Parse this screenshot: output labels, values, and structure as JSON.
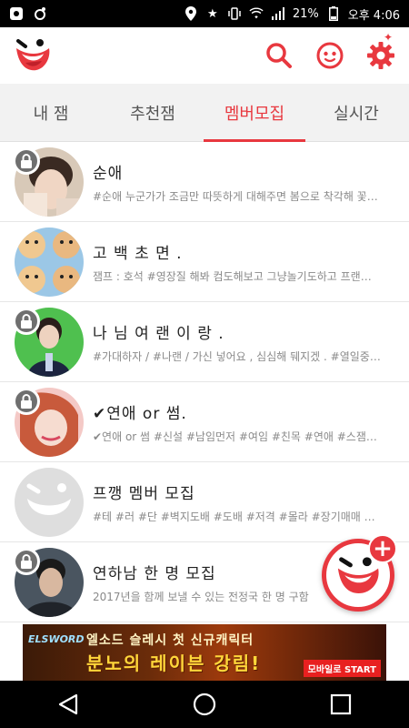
{
  "status_bar": {
    "battery_percent": "21%",
    "time": "오후 4:06"
  },
  "colors": {
    "accent": "#e8383f",
    "tab_bg": "#f2f2f2",
    "subtitle": "#8a8a8a"
  },
  "header": {
    "logo_icon": "smile-face-logo",
    "actions": [
      "search-icon",
      "face-icon",
      "gear-icon"
    ]
  },
  "tabs": [
    {
      "label": "내 잼",
      "active": false
    },
    {
      "label": "추천잼",
      "active": false
    },
    {
      "label": "멤버모집",
      "active": true
    },
    {
      "label": "실시간",
      "active": false
    }
  ],
  "list": [
    {
      "title": "순애",
      "subtitle": "#순애 누군가가 조금만 따뜻하게 대해주면 봄으로 착각해 꽃…",
      "locked": true
    },
    {
      "title": "고 백 초 면 .",
      "subtitle": "잼프 : 호석  #영장질 해봐 컴도해보고  그냥놀기도하고  프랜…",
      "locked": false
    },
    {
      "title": "나 님 여 랜 이 랑 .",
      "subtitle": "#가대하자 / #나랜 / 가신 넣어요 , 심심해 뒈지겠 .  #열일중…",
      "locked": true
    },
    {
      "title": "✔연애 or 썸.",
      "subtitle": "✔연애 or 썸  #신설 #남임먼저 #여임 #친목 #연애 #스잼…",
      "locked": true
    },
    {
      "title": "프깽 멤버 모집",
      "subtitle": "#테 #러 #단 #벽지도배 #도배 #저격 #몰라 #장기매매  …",
      "locked": false
    },
    {
      "title": "연하남 한 명 모집",
      "subtitle": "2017년을 함께 보낼 수 있는 전정국 한 명 구함",
      "locked": true
    }
  ],
  "fab": {
    "plus": "+"
  },
  "banner": {
    "logo": "ELSWORD",
    "line1": "엘소드 슬레시 첫 신규캐릭터",
    "line2": "분노의 레이븐 강림!",
    "cta": "모바일로 START"
  },
  "nav": [
    "back-icon",
    "home-icon",
    "recents-icon"
  ]
}
